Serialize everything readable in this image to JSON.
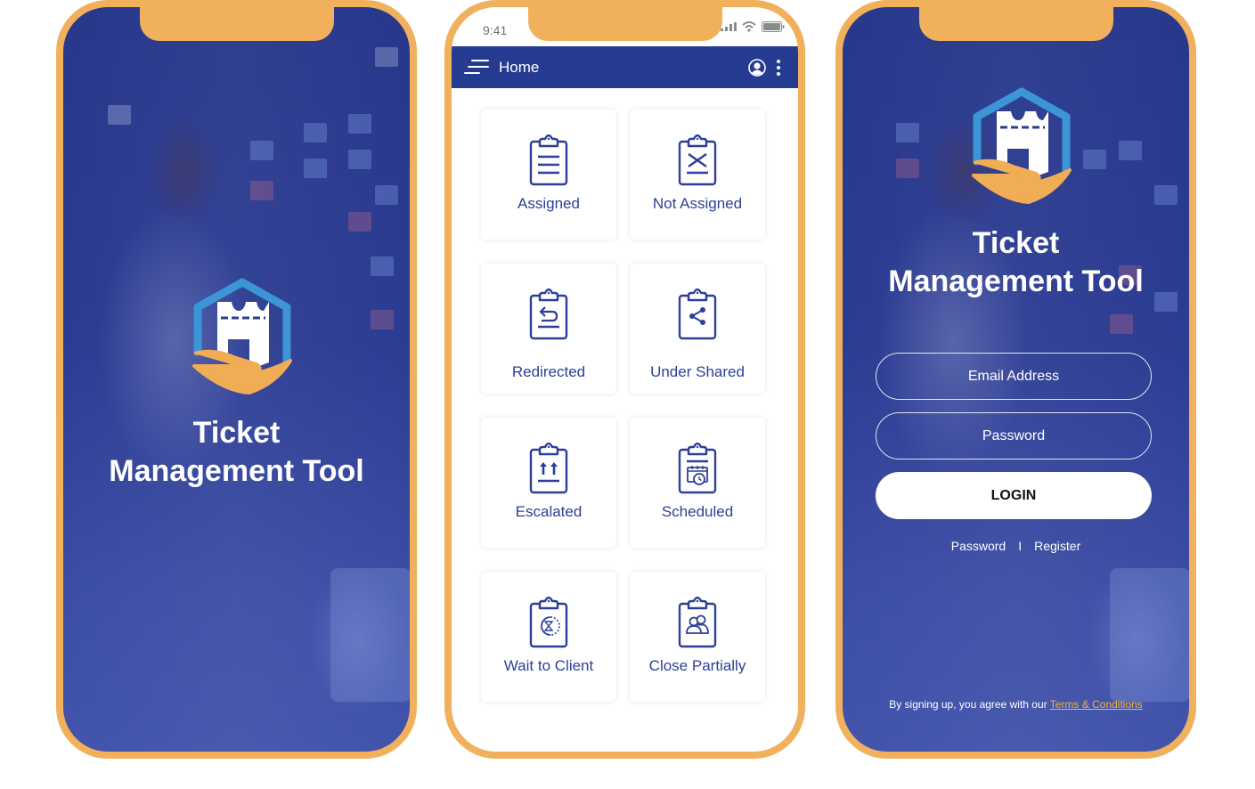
{
  "splash": {
    "title_line1": "Ticket",
    "title_line2": "Management Tool"
  },
  "home": {
    "status_bar": {
      "time": "9:41",
      "icons": [
        "signal-icon",
        "wifi-icon",
        "battery-icon"
      ]
    },
    "app_bar": {
      "title": "Home",
      "menu_icon": "hamburger-menu-icon",
      "profile_icon": "user-avatar-icon",
      "more_icon": "more-vertical-icon"
    },
    "tiles": [
      {
        "label": "Assigned",
        "icon": "clipboard-list-icon"
      },
      {
        "label": "Not Assigned",
        "icon": "clipboard-x-icon"
      },
      {
        "label": "Redirected",
        "icon": "clipboard-redirect-icon"
      },
      {
        "label": "Under Shared",
        "icon": "clipboard-share-icon"
      },
      {
        "label": "Escalated",
        "icon": "clipboard-escalate-icon"
      },
      {
        "label": "Scheduled",
        "icon": "clipboard-calendar-icon"
      },
      {
        "label": "Wait to Client",
        "icon": "clipboard-hourglass-icon"
      },
      {
        "label": "Close Partially",
        "icon": "clipboard-users-icon"
      }
    ]
  },
  "login": {
    "title_line1": "Ticket",
    "title_line2": "Management Tool",
    "email_placeholder": "Email Address",
    "password_placeholder": "Password",
    "login_label": "LOGIN",
    "forgot_password_link": "Password",
    "separator": "I",
    "register_link": "Register",
    "terms_prefix": "By signing up, you agree with our",
    "terms_link": "Terms & Conditions"
  },
  "colors": {
    "frame": "#f0b05c",
    "primary": "#253b92",
    "tile_text": "#2d3f96",
    "link_accent": "#f0b23a",
    "logo_blue": "#3b95d6",
    "logo_orange": "#f0ad55"
  }
}
